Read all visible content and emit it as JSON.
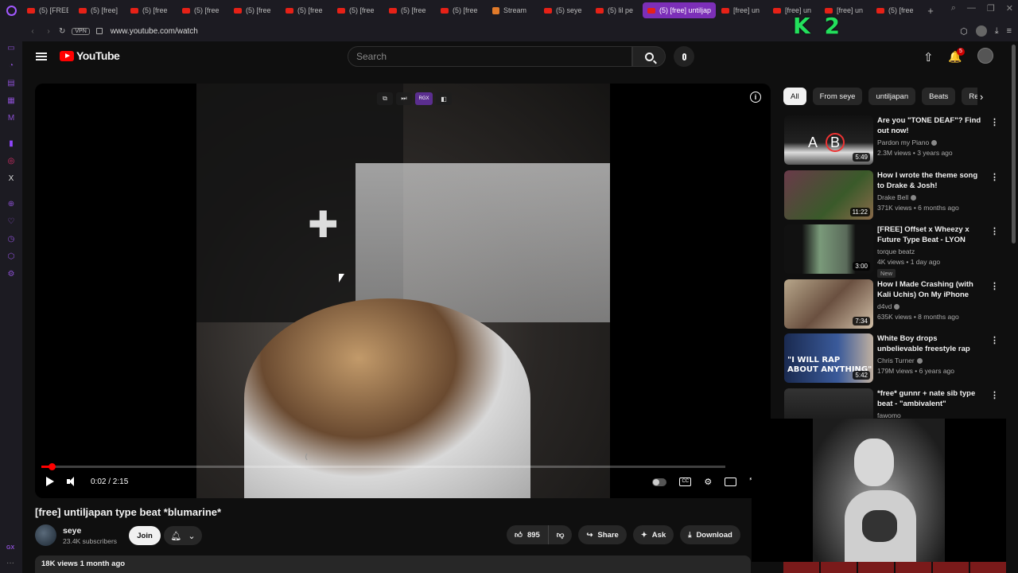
{
  "browser": {
    "tabs": [
      {
        "label": "(5) [FREE"
      },
      {
        "label": "(5) [free]"
      },
      {
        "label": "(5) [free"
      },
      {
        "label": "(5) [free"
      },
      {
        "label": "(5) [free"
      },
      {
        "label": "(5) [free"
      },
      {
        "label": "(5) [free"
      },
      {
        "label": "(5) [free"
      },
      {
        "label": "(5) [free"
      },
      {
        "label": "Stream"
      },
      {
        "label": "(5) seye"
      },
      {
        "label": "(5) lil pe"
      },
      {
        "label": "(5) [free] untiljap"
      },
      {
        "label": "[free] un"
      },
      {
        "label": "[free] un"
      },
      {
        "label": "[free] un"
      },
      {
        "label": "(5) [free"
      }
    ],
    "active_tab_index": 12,
    "new_tab": "+",
    "vpn_label": "VPN",
    "url": "www.youtube.com/watch",
    "overlay_text": "K 2",
    "accent": "#7c2fb8"
  },
  "sidebar": {
    "icons": [
      "messenger-icon",
      "history-icon",
      "wallet-icon",
      "news-icon",
      "music-icon",
      "twitch-icon",
      "instagram-icon",
      "x-icon",
      "add-icon",
      "heart-icon",
      "clock-icon",
      "cube-icon",
      "settings-icon"
    ],
    "gx_label": "GX",
    "more": "···"
  },
  "masthead": {
    "logo_text": "YouTube",
    "search_placeholder": "Search",
    "notification_count": "5"
  },
  "player": {
    "time": "0:02 / 2:15",
    "progress": 0.015,
    "mini_controls": [
      "open-icon",
      "skip-icon",
      "RGX",
      "layout-icon"
    ]
  },
  "chips": [
    "All",
    "From seye",
    "untiljapan",
    "Beats",
    "Rela"
  ],
  "recommendations": [
    {
      "title": "Are you \"TONE DEAF\"? Find out now!",
      "channel": "Pardon my Piano",
      "meta": "2.3M views • 3 years ago",
      "duration": "5:49",
      "verified": true
    },
    {
      "title": "How I wrote the theme song to Drake & Josh!",
      "channel": "Drake Bell",
      "meta": "371K views • 6 months ago",
      "duration": "11:22",
      "verified": true
    },
    {
      "title": "[FREE] Offset x Wheezy x Future Type Beat - LYON",
      "channel": "torque beatz",
      "meta": "4K views • 1 day ago",
      "duration": "3:00",
      "badge": "New",
      "verified": false
    },
    {
      "title": "How I Made Crashing (with Kali Uchis) On My iPhone",
      "channel": "d4vd",
      "meta": "635K views • 8 months ago",
      "duration": "7:34",
      "verified": true
    },
    {
      "title": "White Boy drops unbelievable freestyle rap",
      "channel": "Chris Turner",
      "meta": "179M views • 6 years ago",
      "duration": "5:42",
      "thumb_text": "\"I WILL RAP ABOUT ANYTHING\"",
      "verified": true
    },
    {
      "title": "*free* gunnr + nate sib type beat - \"ambivalent\"",
      "channel": "fawomo",
      "meta": "",
      "duration": "",
      "verified": false
    }
  ],
  "video": {
    "title": "[free] untiljapan type beat *blumarine*",
    "channel": "seye",
    "subscribers": "23.4K subscribers",
    "join_label": "Join",
    "likes": "895",
    "share_label": "Share",
    "ask_label": "Ask",
    "download_label": "Download",
    "views_date": "18K views  1 month ago"
  }
}
